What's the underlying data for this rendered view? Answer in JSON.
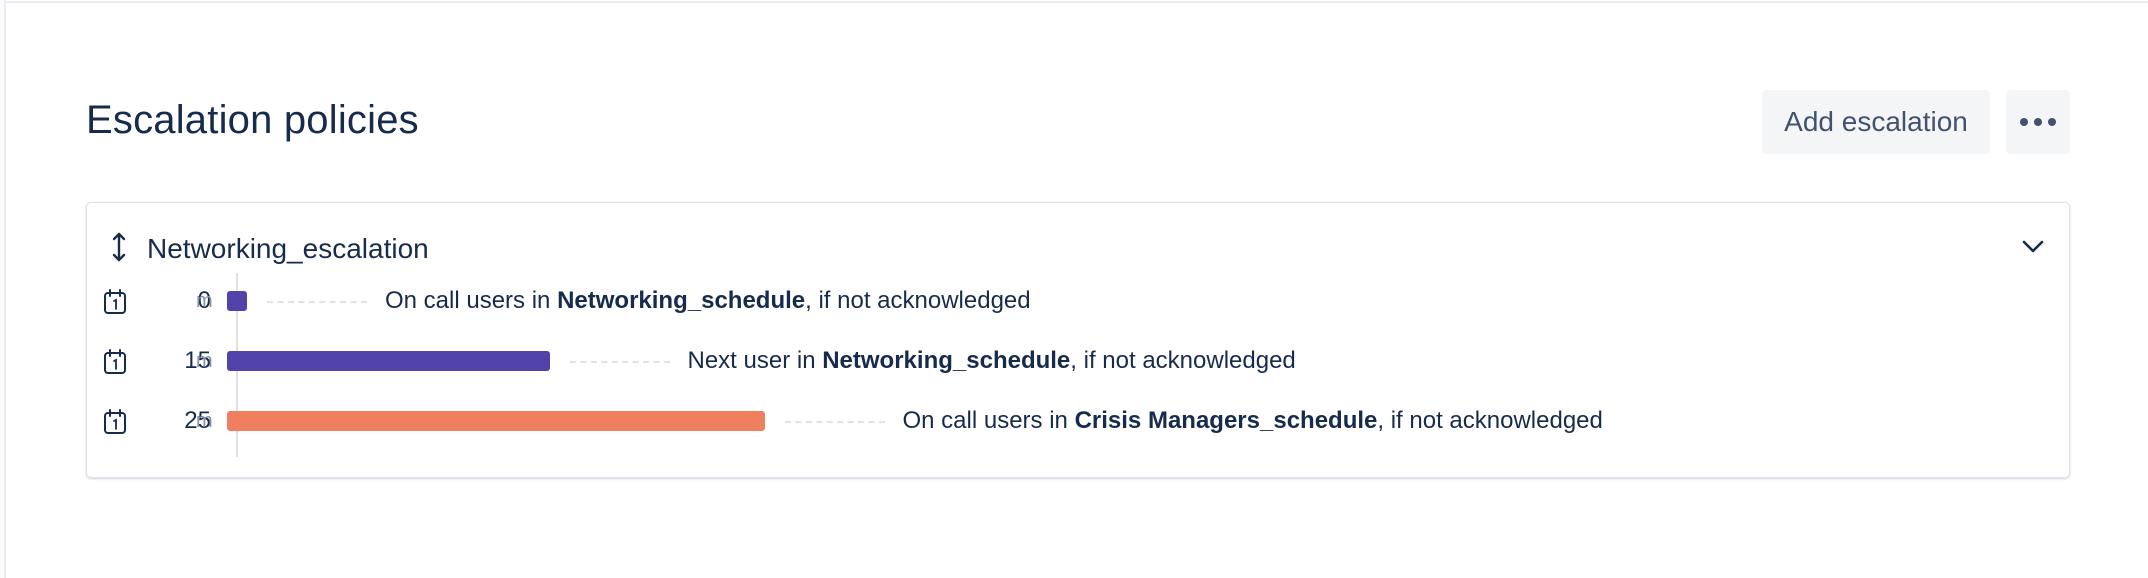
{
  "header": {
    "title": "Escalation policies",
    "add_button_label": "Add escalation",
    "more_button_icon": "more-horizontal-icon"
  },
  "policy": {
    "name": "Networking_escalation",
    "drag_icon": "vertical-arrows-icon",
    "collapse_icon": "chevron-down-icon",
    "rules": [
      {
        "delay": "0",
        "unit": "m",
        "delay_minutes": 0,
        "bar_color": "#5243aa",
        "text_prefix": "On call users in ",
        "schedule": "Networking_schedule",
        "text_suffix": ", if not acknowledged",
        "icon": "calendar-icon"
      },
      {
        "delay": "15",
        "unit": "m",
        "delay_minutes": 15,
        "bar_color": "#5243aa",
        "text_prefix": "Next user in ",
        "schedule": "Networking_schedule",
        "text_suffix": ", if not acknowledged",
        "icon": "calendar-icon"
      },
      {
        "delay": "25",
        "unit": "m",
        "delay_minutes": 25,
        "bar_color": "#f07f5f",
        "text_prefix": "On call users in ",
        "schedule": "Crisis Managers_schedule",
        "text_suffix": ", if not acknowledged",
        "icon": "calendar-icon"
      }
    ]
  }
}
